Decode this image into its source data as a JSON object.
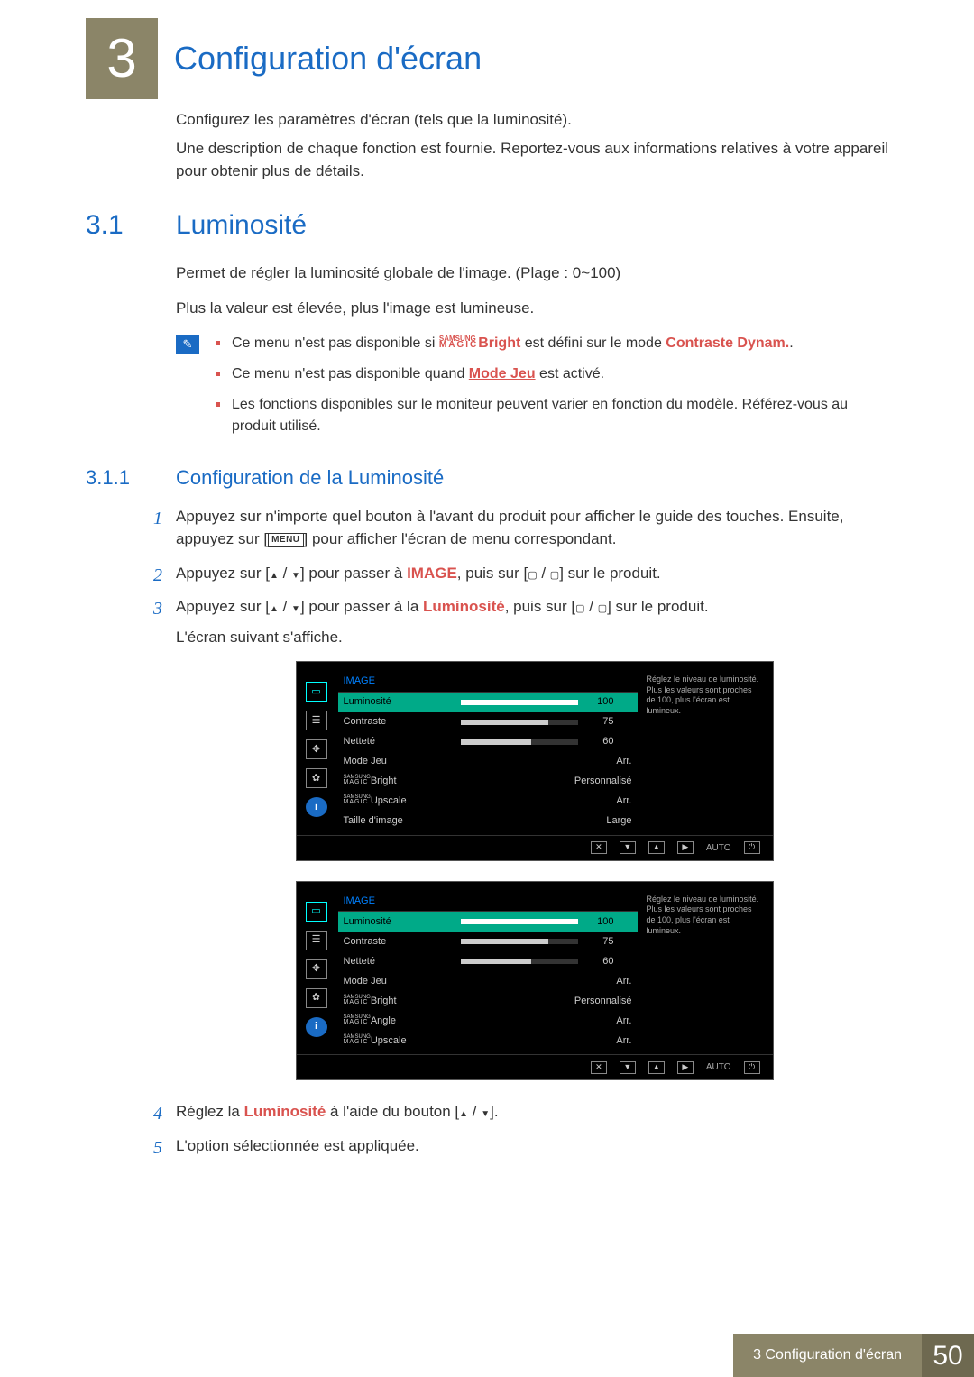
{
  "chapter": {
    "num": "3",
    "title": "Configuration d'écran"
  },
  "intro": {
    "p1": "Configurez les paramètres d'écran (tels que la luminosité).",
    "p2": "Une description de chaque fonction est fournie. Reportez-vous aux informations relatives à votre appareil pour obtenir plus de détails."
  },
  "section31": {
    "num": "3.1",
    "title": "Luminosité",
    "p1": "Permet de régler la luminosité globale de l'image. (Plage : 0~100)",
    "p2": "Plus la valeur est élevée, plus l'image est lumineuse."
  },
  "notes": {
    "n1a": "Ce menu n'est pas disponible si ",
    "n1b": "Bright",
    "n1c": " est défini sur le mode ",
    "n1d": "Contraste Dynam.",
    "n1e": ".",
    "n2a": "Ce menu n'est pas disponible quand ",
    "n2b": "Mode Jeu",
    "n2c": " est activé.",
    "n3": "Les fonctions disponibles sur le moniteur peuvent varier en fonction du modèle. Référez-vous au produit utilisé."
  },
  "sub311": {
    "num": "3.1.1",
    "title": "Configuration de la Luminosité"
  },
  "steps": {
    "s1": "Appuyez sur n'importe quel bouton à l'avant du produit pour afficher le guide des touches. Ensuite, appuyez sur [",
    "s1menu": "MENU",
    "s1b": "] pour afficher l'écran de menu correspondant.",
    "s2a": "Appuyez sur [",
    "s2b": "] pour passer à ",
    "s2img": "IMAGE",
    "s2c": ", puis sur [",
    "s2d": "] sur le produit.",
    "s3a": "Appuyez sur [",
    "s3b": "] pour passer à la ",
    "s3lum": "Luminosité",
    "s3c": ", puis sur [",
    "s3d": "] sur le produit.",
    "s3e": "L'écran suivant s'affiche.",
    "s4a": "Réglez la ",
    "s4b": "Luminosité",
    "s4c": " à l'aide du bouton [",
    "s4d": "].",
    "s5": "L'option sélectionnée est appliquée."
  },
  "osd": {
    "title": "IMAGE",
    "help": "Réglez le niveau de luminosité. Plus les valeurs sont proches de 100, plus l'écran est lumineux.",
    "auto": "AUTO",
    "rows1": [
      {
        "label": "Luminosité",
        "value": "100",
        "bar": 100,
        "sel": true
      },
      {
        "label": "Contraste",
        "value": "75",
        "bar": 75
      },
      {
        "label": "Netteté",
        "value": "60",
        "bar": 60
      },
      {
        "label": "Mode Jeu",
        "value": "Arr."
      },
      {
        "label": "Bright",
        "magic": true,
        "value": "Personnalisé"
      },
      {
        "label": "Upscale",
        "magic": true,
        "value": "Arr."
      },
      {
        "label": "Taille d'image",
        "value": "Large"
      }
    ],
    "rows2": [
      {
        "label": "Luminosité",
        "value": "100",
        "bar": 100,
        "sel": true
      },
      {
        "label": "Contraste",
        "value": "75",
        "bar": 75
      },
      {
        "label": "Netteté",
        "value": "60",
        "bar": 60
      },
      {
        "label": "Mode Jeu",
        "value": "Arr."
      },
      {
        "label": "Bright",
        "magic": true,
        "value": "Personnalisé"
      },
      {
        "label": "Angle",
        "magic": true,
        "value": "Arr."
      },
      {
        "label": "Upscale",
        "magic": true,
        "value": "Arr."
      }
    ]
  },
  "footer": {
    "label": "3 Configuration d'écran",
    "page": "50"
  },
  "magic": {
    "top": "SAMSUNG",
    "bottom": "MAGIC"
  }
}
